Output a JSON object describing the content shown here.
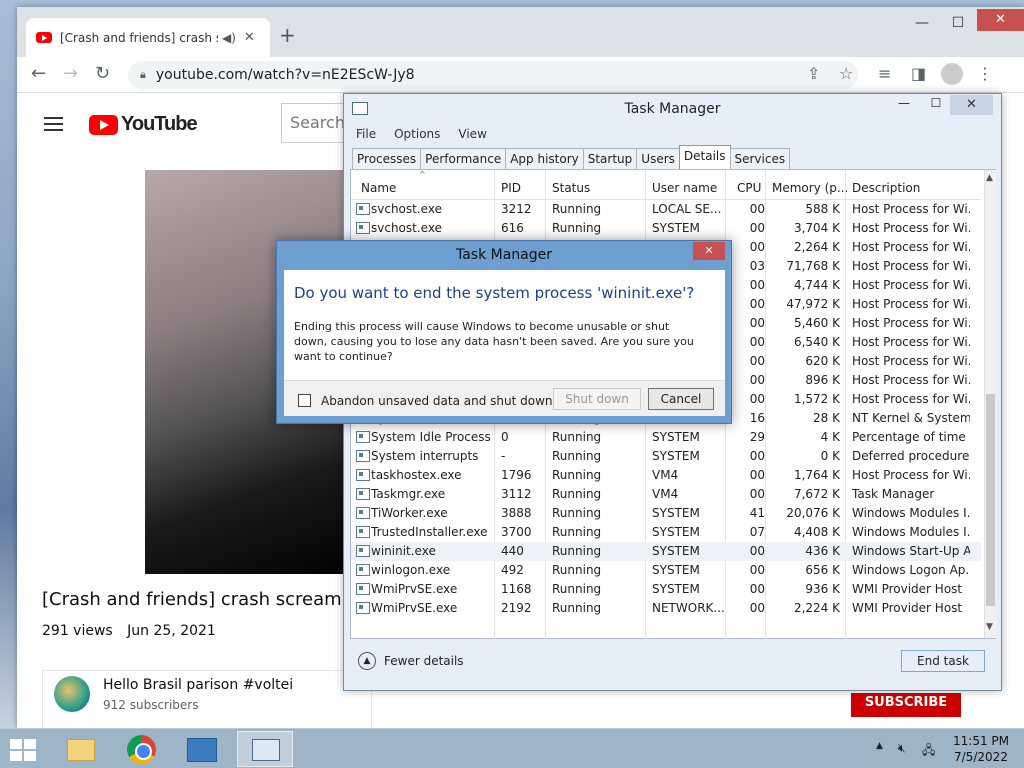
{
  "browser": {
    "tab_title": "[Crash and friends] crash scream",
    "tab_audio_icon": "speaker-icon",
    "tab_close": "✕",
    "new_tab": "+",
    "url": "youtube.com/watch?v=nE2EScW-Jy8",
    "window_controls": {
      "minimize": "—",
      "maximize": "☐",
      "close": "✕"
    }
  },
  "youtube": {
    "logo_text": "YouTube",
    "search_placeholder": "Search",
    "video_title": "[Crash and friends] crash scream co",
    "views": "291 views",
    "date": "Jun 25, 2021",
    "channel_name": "Hello Brasil parison #voltei",
    "channel_subs": "912 subscribers",
    "subscribe": "SUBSCRIBE"
  },
  "task_manager": {
    "title": "Task Manager",
    "menu": [
      "File",
      "Options",
      "View"
    ],
    "tabs": [
      "Processes",
      "Performance",
      "App history",
      "Startup",
      "Users",
      "Details",
      "Services"
    ],
    "active_tab": "Details",
    "columns": [
      "Name",
      "PID",
      "Status",
      "User name",
      "CPU",
      "Memory (p...",
      "Description"
    ],
    "rows": [
      {
        "name": "svchost.exe",
        "pid": "3212",
        "status": "Running",
        "user": "LOCAL SE...",
        "cpu": "00",
        "mem": "588 K",
        "desc": "Host Process for Wi..."
      },
      {
        "name": "svchost.exe",
        "pid": "616",
        "status": "Running",
        "user": "SYSTEM",
        "cpu": "00",
        "mem": "3,704 K",
        "desc": "Host Process for Wi..."
      },
      {
        "name": "",
        "pid": "",
        "status": "",
        "user": "",
        "cpu": "00",
        "mem": "2,264 K",
        "desc": "Host Process for Wi..."
      },
      {
        "name": "",
        "pid": "",
        "status": "",
        "user": "",
        "cpu": "03",
        "mem": "71,768 K",
        "desc": "Host Process for Wi..."
      },
      {
        "name": "",
        "pid": "",
        "status": "",
        "user": "",
        "cpu": "00",
        "mem": "4,744 K",
        "desc": "Host Process for Wi..."
      },
      {
        "name": "",
        "pid": "",
        "status": "",
        "user": "",
        "cpu": "00",
        "mem": "47,972 K",
        "desc": "Host Process for Wi..."
      },
      {
        "name": "",
        "pid": "",
        "status": "",
        "user": "",
        "cpu": "00",
        "mem": "5,460 K",
        "desc": "Host Process for Wi..."
      },
      {
        "name": "",
        "pid": "",
        "status": "",
        "user": "",
        "cpu": "00",
        "mem": "6,540 K",
        "desc": "Host Process for Wi..."
      },
      {
        "name": "",
        "pid": "",
        "status": "",
        "user": "",
        "cpu": "00",
        "mem": "620 K",
        "desc": "Host Process for Wi..."
      },
      {
        "name": "",
        "pid": "",
        "status": "",
        "user": "",
        "cpu": "00",
        "mem": "896 K",
        "desc": "Host Process for Wi..."
      },
      {
        "name": "",
        "pid": "",
        "status": "",
        "user": "",
        "cpu": "00",
        "mem": "1,572 K",
        "desc": "Host Process for Wi..."
      },
      {
        "name": "System",
        "pid": "4",
        "status": "Running",
        "user": "SYSTEM",
        "cpu": "16",
        "mem": "28 K",
        "desc": "NT Kernel & System"
      },
      {
        "name": "System Idle Process",
        "pid": "0",
        "status": "Running",
        "user": "SYSTEM",
        "cpu": "29",
        "mem": "4 K",
        "desc": "Percentage of time t..."
      },
      {
        "name": "System interrupts",
        "pid": "-",
        "status": "Running",
        "user": "SYSTEM",
        "cpu": "00",
        "mem": "0 K",
        "desc": "Deferred procedure ..."
      },
      {
        "name": "taskhostex.exe",
        "pid": "1796",
        "status": "Running",
        "user": "VM4",
        "cpu": "00",
        "mem": "1,764 K",
        "desc": "Host Process for Wi..."
      },
      {
        "name": "Taskmgr.exe",
        "pid": "3112",
        "status": "Running",
        "user": "VM4",
        "cpu": "00",
        "mem": "7,672 K",
        "desc": "Task Manager"
      },
      {
        "name": "TiWorker.exe",
        "pid": "3888",
        "status": "Running",
        "user": "SYSTEM",
        "cpu": "41",
        "mem": "20,076 K",
        "desc": "Windows Modules I..."
      },
      {
        "name": "TrustedInstaller.exe",
        "pid": "3700",
        "status": "Running",
        "user": "SYSTEM",
        "cpu": "07",
        "mem": "4,408 K",
        "desc": "Windows Modules I..."
      },
      {
        "name": "wininit.exe",
        "pid": "440",
        "status": "Running",
        "user": "SYSTEM",
        "cpu": "00",
        "mem": "436 K",
        "desc": "Windows Start-Up A...",
        "selected": true
      },
      {
        "name": "winlogon.exe",
        "pid": "492",
        "status": "Running",
        "user": "SYSTEM",
        "cpu": "00",
        "mem": "656 K",
        "desc": "Windows Logon Ap..."
      },
      {
        "name": "WmiPrvSE.exe",
        "pid": "1168",
        "status": "Running",
        "user": "SYSTEM",
        "cpu": "00",
        "mem": "936 K",
        "desc": "WMI Provider Host"
      },
      {
        "name": "WmiPrvSE.exe",
        "pid": "2192",
        "status": "Running",
        "user": "NETWORK...",
        "cpu": "00",
        "mem": "2,224 K",
        "desc": "WMI Provider Host"
      }
    ],
    "fewer_details": "Fewer details",
    "end_task": "End task"
  },
  "dialog": {
    "title": "Task Manager",
    "question": "Do you want to end the system process 'wininit.exe'?",
    "message": "Ending this process will cause Windows to become unusable or shut down, causing you to lose any data hasn't been saved. Are you sure you want to continue?",
    "checkbox_label": "Abandon unsaved data and shut down.",
    "checkbox_checked": false,
    "shutdown_button": "Shut down",
    "cancel_button": "Cancel",
    "close": "✕"
  },
  "taskbar": {
    "apps": [
      "file-explorer-icon",
      "chrome-icon",
      "control-panel-icon",
      "task-manager-icon"
    ],
    "active_app": "task-manager-icon",
    "time": "11:51 PM",
    "date": "7/5/2022"
  }
}
